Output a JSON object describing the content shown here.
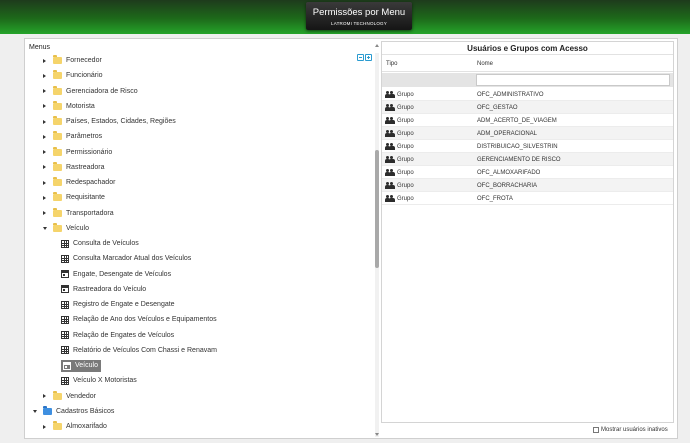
{
  "header": {
    "title": "Permissões por Menu",
    "subtitle": "LATROMI TECHNOLOGY"
  },
  "menus": {
    "label": "Menus",
    "tree": [
      {
        "label": "Fornecedor",
        "type": "folder",
        "level": 1,
        "expanded": false
      },
      {
        "label": "Funcionário",
        "type": "folder",
        "level": 1,
        "expanded": false
      },
      {
        "label": "Gerenciadora de Risco",
        "type": "folder",
        "level": 1,
        "expanded": false
      },
      {
        "label": "Motorista",
        "type": "folder",
        "level": 1,
        "expanded": false
      },
      {
        "label": "Países, Estados, Cidades, Regiões",
        "type": "folder",
        "level": 1,
        "expanded": false
      },
      {
        "label": "Parâmetros",
        "type": "folder",
        "level": 1,
        "expanded": false
      },
      {
        "label": "Permissionário",
        "type": "folder",
        "level": 1,
        "expanded": false
      },
      {
        "label": "Rastreadora",
        "type": "folder",
        "level": 1,
        "expanded": false
      },
      {
        "label": "Redespachador",
        "type": "folder",
        "level": 1,
        "expanded": false
      },
      {
        "label": "Requisitante",
        "type": "folder",
        "level": 1,
        "expanded": false
      },
      {
        "label": "Transportadora",
        "type": "folder",
        "level": 1,
        "expanded": false
      },
      {
        "label": "Veículo",
        "type": "folder",
        "level": 1,
        "expanded": true
      },
      {
        "label": "Consulta de Veículos",
        "type": "grid",
        "level": 2
      },
      {
        "label": "Consulta Marcador Atual dos Veículos",
        "type": "grid",
        "level": 2
      },
      {
        "label": "Engate, Desengate de Veículos",
        "type": "form",
        "level": 2
      },
      {
        "label": "Rastreadora do Veículo",
        "type": "form",
        "level": 2
      },
      {
        "label": "Registro de Engate e Desengate",
        "type": "grid",
        "level": 2
      },
      {
        "label": "Relação de Ano dos Veículos e Equipamentos",
        "type": "grid",
        "level": 2
      },
      {
        "label": "Relação de Engates de Veículos",
        "type": "grid",
        "level": 2
      },
      {
        "label": "Relatório de Veículos Com Chassi e Renavam",
        "type": "grid",
        "level": 2
      },
      {
        "label": "Veículo",
        "type": "form",
        "level": 2,
        "selected": true
      },
      {
        "label": "Veículo X Motoristas",
        "type": "grid",
        "level": 2
      },
      {
        "label": "Vendedor",
        "type": "folder",
        "level": 1,
        "expanded": false
      },
      {
        "label": "Cadastros Básicos",
        "type": "folder-blue",
        "level": 0,
        "expanded": true
      },
      {
        "label": "Almoxarifado",
        "type": "folder",
        "level": 1,
        "expanded": false
      }
    ]
  },
  "access": {
    "title": "Usuários e Grupos com Acesso",
    "col_tipo": "Tipo",
    "col_nome": "Nome",
    "rows": [
      {
        "tipo": "Grupo",
        "nome": "OFC_ADMINISTRATIVO"
      },
      {
        "tipo": "Grupo",
        "nome": "OFC_GESTAO"
      },
      {
        "tipo": "Grupo",
        "nome": "ADM_ACERTO_DE_VIAGEM"
      },
      {
        "tipo": "Grupo",
        "nome": "ADM_OPERACIONAL"
      },
      {
        "tipo": "Grupo",
        "nome": "DISTRIBUICAO_SILVESTRIN"
      },
      {
        "tipo": "Grupo",
        "nome": "GERENCIAMENTO DE RISCO"
      },
      {
        "tipo": "Grupo",
        "nome": "OFC_ALMOXARIFADO"
      },
      {
        "tipo": "Grupo",
        "nome": "OFC_BORRACHARIA"
      },
      {
        "tipo": "Grupo",
        "nome": "OFC_FROTA"
      }
    ],
    "show_inactive_label": "Mostrar usuários inativos",
    "show_inactive_checked": false
  },
  "icons": {
    "folder": "folder-icon",
    "grid": "grid-icon",
    "form": "form-icon",
    "users": "users-icon",
    "expand_collapse": "expand-collapse-icon"
  }
}
